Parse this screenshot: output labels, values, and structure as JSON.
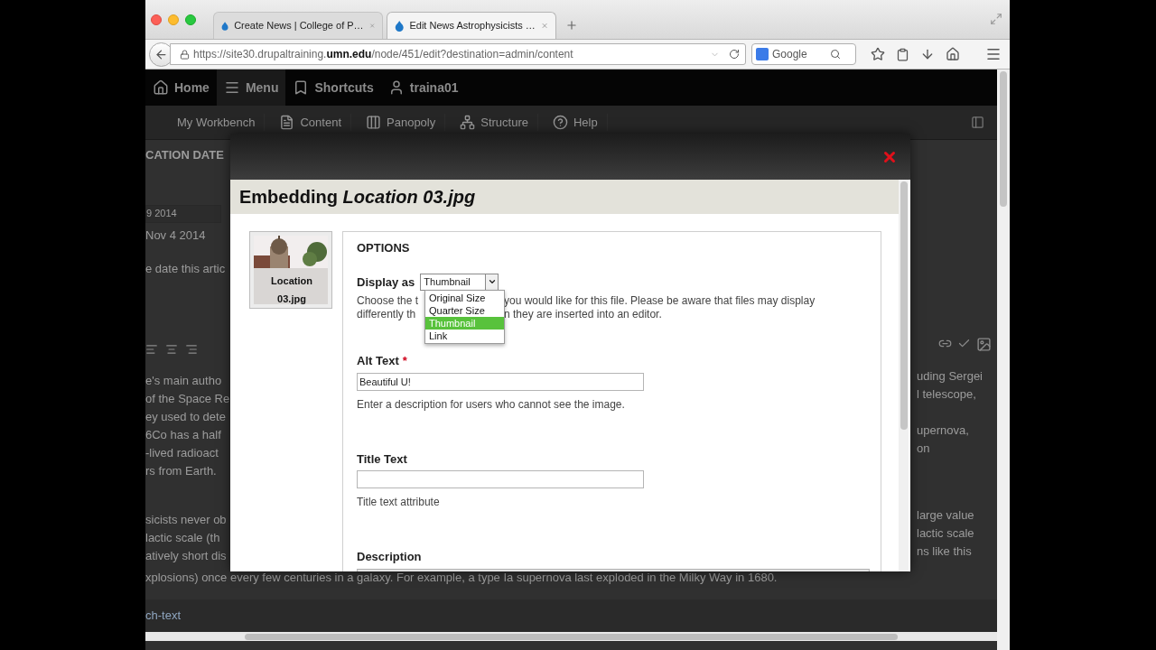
{
  "browser": {
    "tabs": [
      {
        "title": "Create News | College of P…",
        "selected": false
      },
      {
        "title": "Edit News Astrophysicists …",
        "selected": true
      }
    ],
    "url": "https://site30.drupaltraining.**umn.edu**/node/451/edit?destination=admin/content",
    "search_field": {
      "placeholder": "Google"
    }
  },
  "admin_toolbar": {
    "items": [
      {
        "label": "Home",
        "selected": false
      },
      {
        "label": "Menu",
        "selected": true
      },
      {
        "label": "Shortcuts",
        "selected": false
      },
      {
        "label": "traina01",
        "selected": false
      }
    ]
  },
  "secondary_toolbar": {
    "items": [
      "My Workbench",
      "Content",
      "Panopoly",
      "Structure",
      "Help"
    ]
  },
  "background_page": {
    "left": {
      "heading": "CATION DATE",
      "date_field": "9 2014",
      "date_text": "Nov 4 2014",
      "hint": "e date this artic",
      "paragraphs": [
        [
          "e's main autho",
          "of the Space Re",
          "ey used to dete",
          "6Co has a half",
          "-lived radioact",
          "rs from Earth."
        ],
        [
          "sicists never ob",
          "lactic scale (th",
          "atively short dis"
        ]
      ]
    },
    "right": {
      "paragraphs": [
        [
          "uding Sergei",
          "l telescope,"
        ],
        [
          "upernova,",
          "on"
        ],
        [
          "large value",
          "lactic scale",
          "ns like this"
        ]
      ]
    },
    "full_line": "xplosions) once every few centuries in a galaxy. For example, a type Ia supernova last exploded in the Milky Way in 1680.",
    "footer_link": "ch-text"
  },
  "modal": {
    "title": "Embedding *Location 03.jpg*",
    "thumbnail": {
      "caption": "Location 03.jpg"
    },
    "options": {
      "legend": "OPTIONS",
      "display_as": {
        "label": "Display as",
        "value": "Thumbnail",
        "expanded": true,
        "options": [
          {
            "label": "Original Size",
            "selected": false
          },
          {
            "label": "Quarter Size",
            "selected": false
          },
          {
            "label": "Thumbnail",
            "selected": true
          },
          {
            "label": "Link",
            "selected": false
          }
        ]
      },
      "help_lines": [
        [
          "Choose the t",
          "you would like for this file. Please be aware that files may display"
        ],
        [
          "differently th",
          "n they are inserted into an editor."
        ]
      ]
    },
    "fields": [
      {
        "kind": "input",
        "label": "Alt Text",
        "required_mark": "*",
        "value": "Beautiful U!",
        "help": "Enter a description for users who cannot see the image."
      },
      {
        "kind": "input",
        "label": "Title Text",
        "help": "Title text attribute"
      },
      {
        "kind": "textarea",
        "label": "Description"
      }
    ]
  }
}
